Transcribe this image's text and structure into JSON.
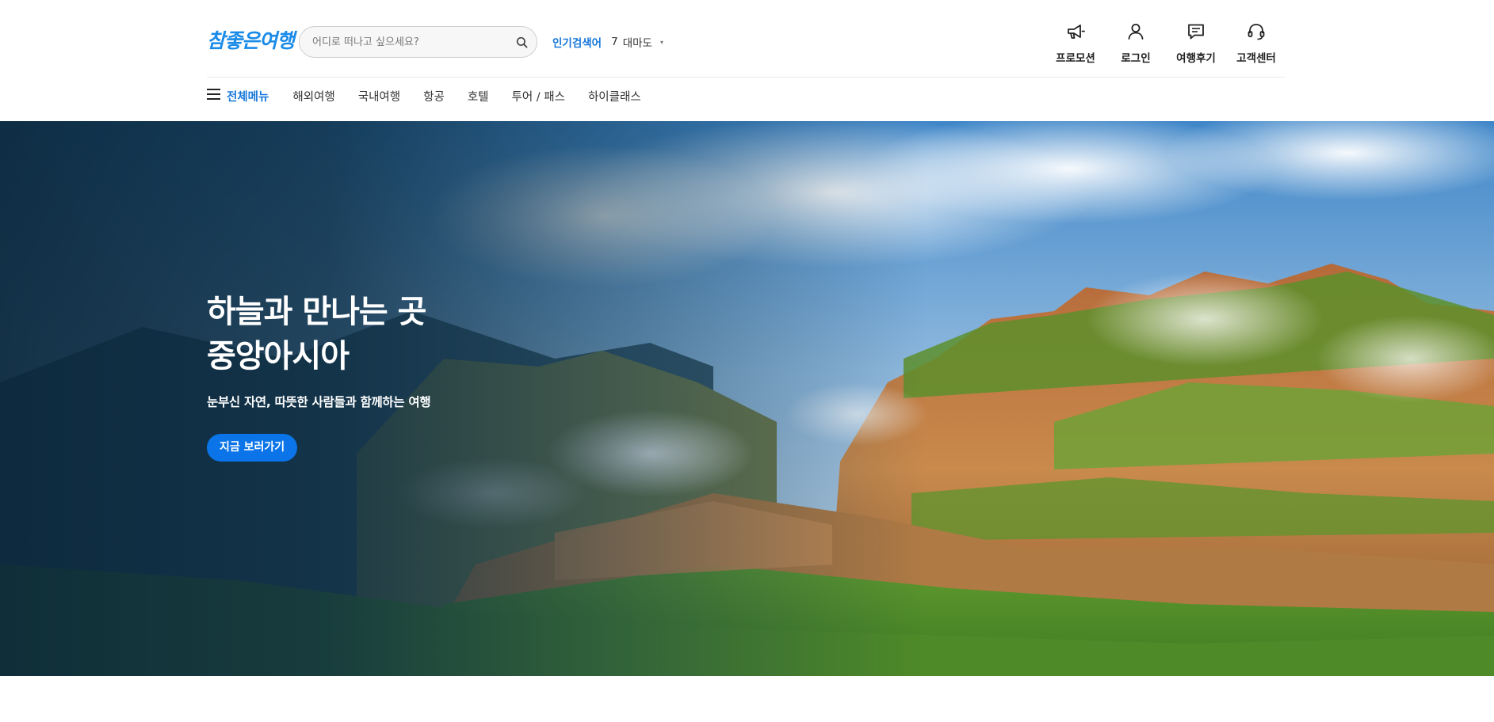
{
  "header": {
    "logo_text": "참좋은여행",
    "search": {
      "placeholder": "어디로 떠나고 싶으세요?",
      "value": ""
    },
    "popular": {
      "label": "인기검색어",
      "rank": "7",
      "keyword": "대마도",
      "caret": "▾"
    },
    "util": [
      {
        "label": "프로모션",
        "icon": "megaphone-icon"
      },
      {
        "label": "로그인",
        "icon": "user-icon"
      },
      {
        "label": "여행후기",
        "icon": "chat-icon"
      },
      {
        "label": "고객센터",
        "icon": "headset-icon"
      }
    ],
    "nav": {
      "all_menu": "전체메뉴",
      "items": [
        "해외여행",
        "국내여행",
        "항공",
        "호텔",
        "투어 / 패스",
        "하이클래스"
      ]
    }
  },
  "hero": {
    "title": "하늘과 만나는 곳\n중앙아시아",
    "subtitle": "눈부신 자연, 따뜻한 사람들과 함께하는 여행",
    "button": "지금 보러가기"
  },
  "colors": {
    "brand": "#1a8be8",
    "accent": "#1677d9",
    "button": "#0a74e8"
  }
}
